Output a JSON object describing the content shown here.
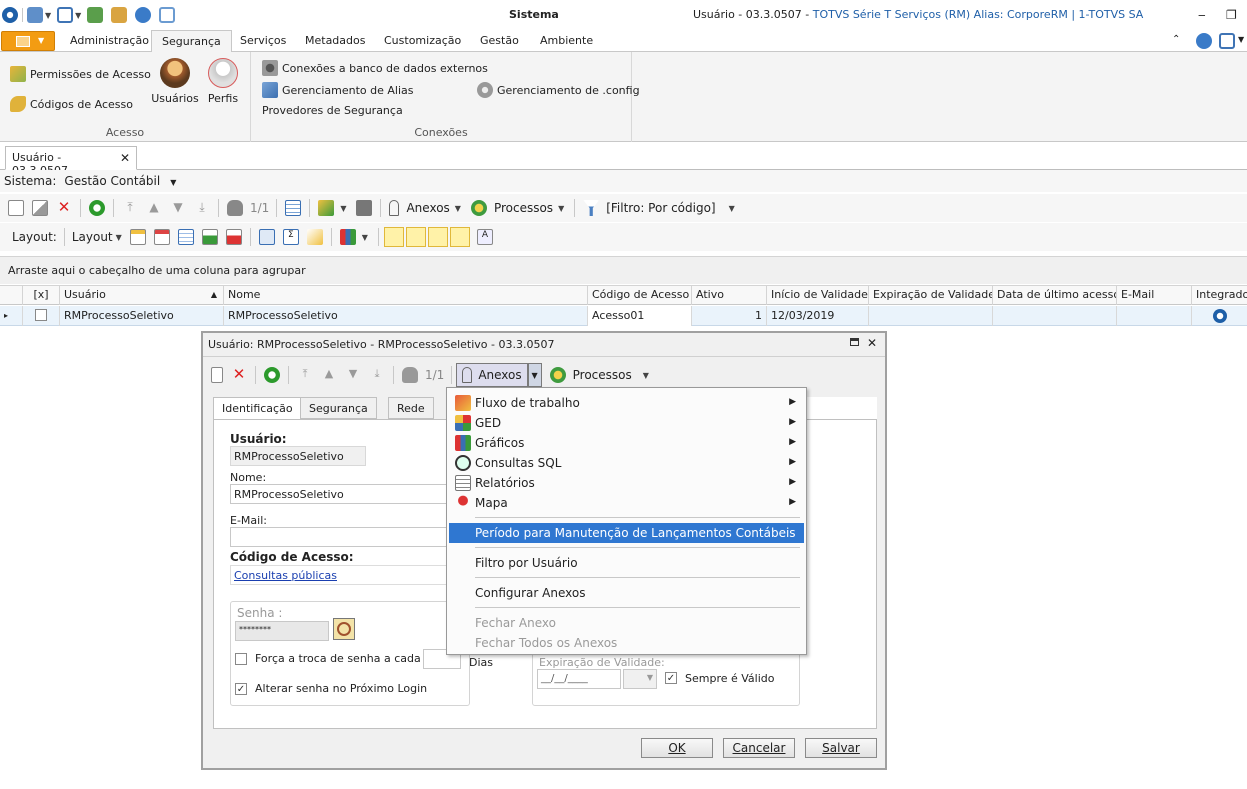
{
  "window": {
    "title": "Sistema",
    "info_prefix": "Usuário - 03.3.0507 - ",
    "info_suffix": "TOTVS Série T Serviços (RM) Alias: CorporeRM | 1-TOTVS SA"
  },
  "ribbon": {
    "tabs": [
      "Administração",
      "Segurança",
      "Serviços",
      "Metadados",
      "Customização",
      "Gestão",
      "Ambiente"
    ],
    "active_tab": "Segurança",
    "groups": {
      "acesso": {
        "label": "Acesso",
        "items": [
          "Permissões de Acesso",
          "Códigos de Acesso"
        ],
        "large_items": [
          "Usuários",
          "Perfis"
        ]
      },
      "conexoes": {
        "label": "Conexões",
        "items": [
          "Conexões a banco de dados externos",
          "Gerenciamento de Alias",
          "Provedores de Segurança",
          "Gerenciamento de .config"
        ]
      }
    }
  },
  "doc_tab": {
    "label": "Usuário - 03.3.0507",
    "close": "✕"
  },
  "sistema": {
    "label": "Sistema:",
    "value": "Gestão Contábil"
  },
  "toolbar": {
    "page": "1/1",
    "anexos": "Anexos",
    "processos": "Processos",
    "filtro": "[Filtro: Por código]",
    "layout_label": "Layout:",
    "layout_menu": "Layout"
  },
  "grid": {
    "group_hint": "Arraste aqui o cabeçalho de uma coluna para agrupar",
    "columns": [
      "[x]",
      "Usuário",
      "Nome",
      "Código de Acesso",
      "Ativo",
      "Início de Validade",
      "Expiração de Validade",
      "Data de último acesso",
      "E-Mail",
      "Integrado"
    ],
    "row": {
      "usuario": "RMProcessoSeletivo",
      "nome": "RMProcessoSeletivo",
      "codigo": "Acesso01",
      "ativo": "1",
      "inicio": "12/03/2019"
    }
  },
  "dialog": {
    "title": "Usuário: RMProcessoSeletivo - RMProcessoSeletivo - 03.3.0507",
    "page": "1/1",
    "anexos": "Anexos",
    "processos": "Processos",
    "tabs": [
      "Identificação",
      "Segurança",
      "Rede"
    ],
    "usuario_label": "Usuário:",
    "usuario_value": "RMProcessoSeletivo",
    "nome_label": "Nome:",
    "nome_value": "RMProcessoSeletivo",
    "email_label": "E-Mail:",
    "email_value": "",
    "codigo_label": "Código de Acesso:",
    "codigo_link": "Consultas públicas",
    "senha_label": "Senha :",
    "senha_value": "********",
    "forca_label": "Força a troca de senha a cada",
    "dias_label": "Dias",
    "alterar_label": "Alterar senha no Próximo Login",
    "expiracao_label": "Expiração de Validade:",
    "expiracao_value": "__/__/____",
    "sempre_label": "Sempre é Válido",
    "ok": "OK",
    "cancelar": "Cancelar",
    "salvar": "Salvar"
  },
  "menu": {
    "items": [
      {
        "label": "Fluxo de trabalho",
        "submenu": true
      },
      {
        "label": "GED",
        "submenu": true
      },
      {
        "label": "Gráficos",
        "submenu": true
      },
      {
        "label": "Consultas SQL",
        "submenu": true
      },
      {
        "label": "Relatórios",
        "submenu": true
      },
      {
        "label": "Mapa",
        "submenu": true
      },
      {
        "label": "Período para Manutenção de Lançamentos Contábeis",
        "highlighted": true
      },
      {
        "label": "Filtro por Usuário"
      },
      {
        "label": "Configurar Anexos"
      },
      {
        "label": "Fechar Anexo",
        "disabled": true
      },
      {
        "label": "Fechar Todos os Anexos",
        "disabled": true
      }
    ]
  },
  "colors": {
    "accent_orange": "#f39c12",
    "highlight_blue": "#2f77d1",
    "info_blue": "#1f5fa8"
  }
}
